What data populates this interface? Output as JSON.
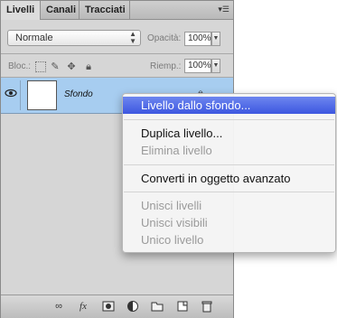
{
  "tabs": [
    "Livelli",
    "Canali",
    "Tracciati"
  ],
  "panel_menu_icon": "panel-menu-icon",
  "blend_mode": "Normale",
  "opacity_label": "Opacità:",
  "opacity_value": "100%",
  "lock_label": "Bloc.:",
  "fill_label": "Riemp.:",
  "fill_value": "100%",
  "layer": {
    "name": "Sfondo"
  },
  "bottom_icons": [
    "link-icon",
    "fx-icon",
    "mask-icon",
    "adjustment-icon",
    "group-folder-icon",
    "new-layer-icon",
    "trash-icon"
  ],
  "context_menu": {
    "items": [
      {
        "label": "Livello dallo sfondo...",
        "enabled": true,
        "highlighted": true
      },
      {
        "label": "Duplica livello...",
        "enabled": true
      },
      {
        "label": "Elimina livello",
        "enabled": false
      },
      {
        "label": "Converti in oggetto avanzato",
        "enabled": true
      },
      {
        "label": "Unisci livelli",
        "enabled": false
      },
      {
        "label": "Unisci visibili",
        "enabled": false
      },
      {
        "label": "Unico livello",
        "enabled": false
      }
    ]
  },
  "colors": {
    "highlight": "#3d57e0",
    "selected_layer": "#a7cdf0",
    "panel_bg": "#d6d6d6"
  }
}
